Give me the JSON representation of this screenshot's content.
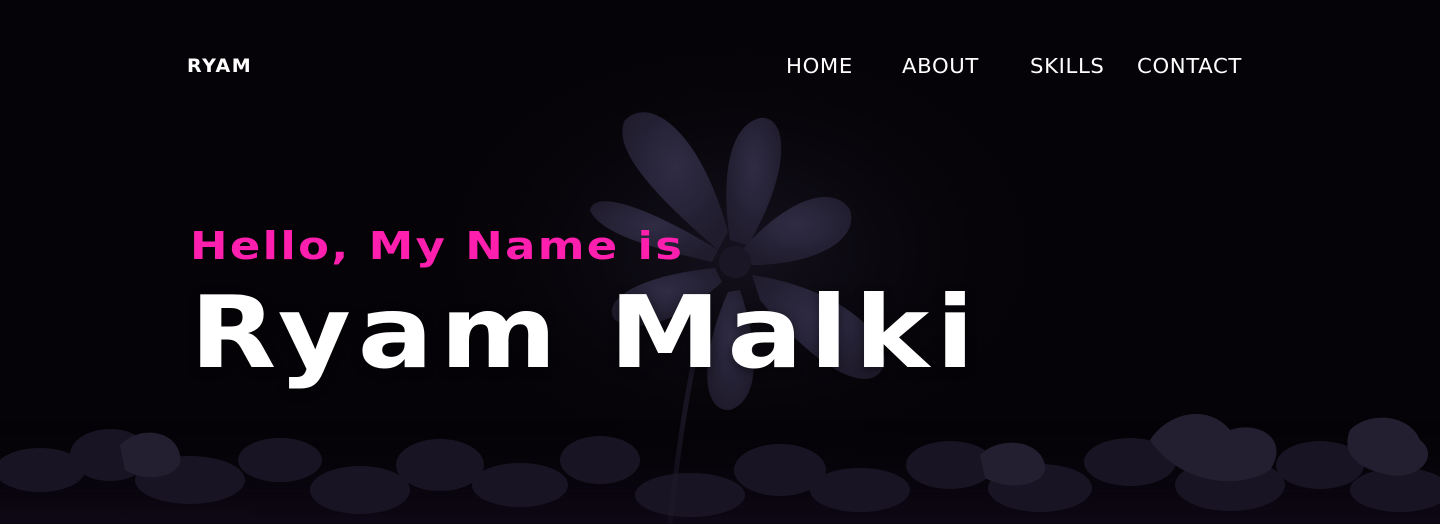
{
  "brand": {
    "logo_text": "RYAM"
  },
  "nav": {
    "items": [
      {
        "label": "HOME"
      },
      {
        "label": "ABOUT"
      },
      {
        "label": "SKILLS"
      },
      {
        "label": "CONTACT"
      }
    ]
  },
  "hero": {
    "greeting": "Hello, My Name is",
    "name": "Ryam Malki",
    "background_image": "flower-silhouette"
  },
  "colors": {
    "background": "#050307",
    "accent": "#ff1fae",
    "text": "#ffffff",
    "flower_tint": "#2c2840"
  }
}
